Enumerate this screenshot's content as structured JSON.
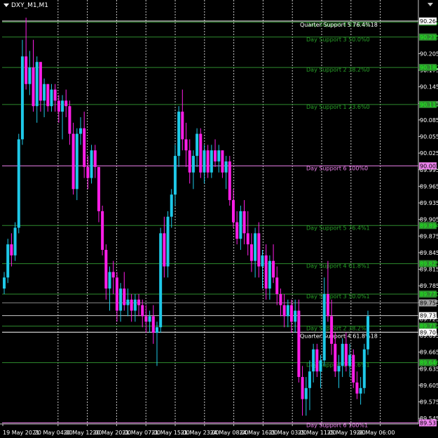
{
  "window": {
    "title": "DXY_M1,M1"
  },
  "colors": {
    "background": "#000000",
    "bull": "#1ec8e8",
    "bear": "#ff1ee8",
    "support_line": "#2e8b2e",
    "support_text": "#28a028",
    "support6_line": "#ee82ee",
    "quarter_line": "#ffffff",
    "grid": "#c8c8c8",
    "axis_text": "#ffffff"
  },
  "chart_data": {
    "type": "candlestick",
    "ylim": [
      89.535,
      90.283
    ],
    "y_ticks": [
      "90.205",
      "90.175",
      "90.145",
      "90.115",
      "90.085",
      "90.055",
      "90.025",
      "89.995",
      "89.965",
      "89.935",
      "89.905",
      "89.875",
      "89.845",
      "89.815",
      "89.785",
      "89.755",
      "89.725",
      "89.695",
      "89.665",
      "89.635",
      "89.605",
      "89.575",
      "89.545"
    ],
    "x_ticks": [
      "19 May 2021",
      "20 May 04:00",
      "20 May 12:00",
      "20 May 20:00",
      "21 May 07:00",
      "21 May 15:00",
      "21 May 23:00",
      "24 May 08:00",
      "24 May 16:00",
      "25 May 03:00",
      "25 May 11:00",
      "25 May 19:00",
      "26 May 06:00"
    ],
    "levels": [
      {
        "value": 90.262,
        "label": "Day Support 4 61.8%0",
        "kind": "support",
        "tag": "90.262"
      },
      {
        "value": 90.264,
        "label": "Quarter Support 5 76.4%18",
        "kind": "quarter",
        "tag": "90.264"
      },
      {
        "value": 90.235,
        "label": "Day Support 3 50.0%0",
        "kind": "support",
        "tag": "90.235"
      },
      {
        "value": 90.18,
        "label": "Day Support 2 38.2%0",
        "kind": "support",
        "tag": "90.180"
      },
      {
        "value": 90.113,
        "label": "Day Support 1 23.6%0",
        "kind": "support",
        "tag": "90.113"
      },
      {
        "value": 90.002,
        "label": "Day Support 6 100%0",
        "kind": "support6",
        "tag": "90.002"
      },
      {
        "value": 89.894,
        "label": "Day Support 5 76.4%1",
        "kind": "support",
        "tag": "89.894"
      },
      {
        "value": 89.825,
        "label": "Day Support 4 61.8%1",
        "kind": "support",
        "tag": "89.825"
      },
      {
        "value": 89.77,
        "label": "Day Support 3 50.0%1",
        "kind": "support",
        "tag": "89.770"
      },
      {
        "value": 89.712,
        "label": "Day Support 2 38.2%1",
        "kind": "support",
        "tag": "89.712"
      },
      {
        "value": 89.701,
        "label": "Quarter Support 4 61.8%18",
        "kind": "quarter",
        "tag": "89.701"
      },
      {
        "value": 89.646,
        "label": "Day Support 1 23.6%1",
        "kind": "support",
        "tag": "89.646"
      },
      {
        "value": 89.537,
        "label": "Day Support 6 100%1",
        "kind": "support6",
        "tag": "89.537"
      }
    ],
    "extra_tags": [
      {
        "value": 89.754,
        "tag": "89.754",
        "kind": "gray"
      },
      {
        "value": 89.731,
        "tag": "89.731",
        "kind": "white"
      }
    ],
    "candles": [
      [
        89.78,
        89.81,
        89.77,
        89.8
      ],
      [
        89.8,
        89.87,
        89.79,
        89.86
      ],
      [
        89.86,
        89.88,
        89.82,
        89.84
      ],
      [
        89.84,
        89.9,
        89.83,
        89.89
      ],
      [
        89.89,
        90.06,
        89.88,
        90.05
      ],
      [
        90.05,
        90.23,
        90.04,
        90.2
      ],
      [
        90.2,
        90.27,
        90.14,
        90.15
      ],
      [
        90.15,
        90.21,
        90.13,
        90.18
      ],
      [
        90.18,
        90.23,
        90.1,
        90.11
      ],
      [
        90.11,
        90.2,
        90.08,
        90.19
      ],
      [
        90.19,
        90.18,
        90.1,
        90.12
      ],
      [
        90.12,
        90.16,
        90.09,
        90.15
      ],
      [
        90.15,
        90.15,
        90.1,
        90.11
      ],
      [
        90.11,
        90.15,
        90.1,
        90.14
      ],
      [
        90.14,
        90.15,
        90.1,
        90.12
      ],
      [
        90.12,
        90.13,
        90.08,
        90.1
      ],
      [
        90.1,
        90.13,
        90.05,
        90.12
      ],
      [
        90.12,
        90.14,
        90.09,
        90.11
      ],
      [
        90.11,
        90.12,
        90.04,
        90.06
      ],
      [
        90.06,
        90.08,
        89.95,
        89.96
      ],
      [
        89.96,
        90.07,
        89.94,
        90.06
      ],
      [
        90.06,
        90.09,
        90.04,
        90.07
      ],
      [
        90.07,
        90.1,
        89.98,
        90.0
      ],
      [
        90.0,
        90.02,
        89.96,
        89.98
      ],
      [
        89.98,
        90.04,
        89.97,
        90.03
      ],
      [
        90.03,
        90.04,
        89.98,
        90.0
      ],
      [
        90.0,
        89.99,
        89.9,
        89.92
      ],
      [
        89.92,
        89.93,
        89.84,
        89.85
      ],
      [
        89.85,
        89.86,
        89.76,
        89.78
      ],
      [
        89.78,
        89.82,
        89.74,
        89.81
      ],
      [
        89.81,
        89.83,
        89.77,
        89.8
      ],
      [
        89.8,
        89.81,
        89.72,
        89.74
      ],
      [
        89.74,
        89.79,
        89.72,
        89.78
      ],
      [
        89.78,
        89.81,
        89.74,
        89.75
      ],
      [
        89.75,
        89.78,
        89.73,
        89.76
      ],
      [
        89.76,
        89.77,
        89.72,
        89.74
      ],
      [
        89.74,
        89.77,
        89.72,
        89.76
      ],
      [
        89.76,
        89.77,
        89.73,
        89.75
      ],
      [
        89.75,
        89.76,
        89.71,
        89.73
      ],
      [
        89.73,
        89.75,
        89.7,
        89.72
      ],
      [
        89.72,
        89.74,
        89.7,
        89.73
      ],
      [
        89.73,
        89.75,
        89.68,
        89.7
      ],
      [
        89.7,
        89.72,
        89.64,
        89.71
      ],
      [
        89.71,
        89.89,
        89.7,
        89.88
      ],
      [
        89.88,
        89.91,
        89.8,
        89.82
      ],
      [
        89.82,
        89.92,
        89.8,
        89.91
      ],
      [
        89.91,
        89.96,
        89.89,
        89.95
      ],
      [
        89.95,
        90.04,
        89.93,
        90.02
      ],
      [
        90.02,
        90.11,
        90.0,
        90.1
      ],
      [
        90.1,
        90.14,
        90.03,
        90.05
      ],
      [
        90.05,
        90.08,
        90.0,
        90.03
      ],
      [
        90.03,
        90.05,
        89.97,
        89.99
      ],
      [
        89.99,
        90.03,
        89.96,
        90.02
      ],
      [
        90.02,
        90.07,
        90.0,
        90.06
      ],
      [
        90.06,
        90.07,
        89.98,
        89.99
      ],
      [
        89.99,
        90.04,
        89.97,
        90.03
      ],
      [
        90.03,
        90.04,
        89.98,
        89.99
      ],
      [
        89.99,
        90.04,
        89.98,
        90.03
      ],
      [
        90.03,
        90.05,
        90.0,
        90.01
      ],
      [
        90.01,
        90.04,
        89.99,
        90.03
      ],
      [
        90.03,
        90.03,
        89.98,
        89.99
      ],
      [
        89.99,
        90.02,
        89.96,
        90.01
      ],
      [
        90.01,
        90.02,
        89.93,
        89.94
      ],
      [
        89.94,
        89.96,
        89.89,
        89.9
      ],
      [
        89.9,
        89.92,
        89.86,
        89.87
      ],
      [
        89.87,
        89.93,
        89.85,
        89.92
      ],
      [
        89.92,
        89.94,
        89.86,
        89.88
      ],
      [
        89.88,
        89.92,
        89.84,
        89.86
      ],
      [
        89.86,
        89.88,
        89.81,
        89.83
      ],
      [
        89.83,
        89.89,
        89.8,
        89.88
      ],
      [
        89.88,
        89.9,
        89.8,
        89.82
      ],
      [
        89.82,
        89.85,
        89.78,
        89.84
      ],
      [
        89.84,
        89.86,
        89.76,
        89.78
      ],
      [
        89.78,
        89.84,
        89.76,
        89.83
      ],
      [
        89.83,
        89.86,
        89.79,
        89.8
      ],
      [
        89.8,
        89.82,
        89.75,
        89.77
      ],
      [
        89.77,
        89.78,
        89.73,
        89.75
      ],
      [
        89.75,
        89.77,
        89.71,
        89.73
      ],
      [
        89.73,
        89.76,
        89.71,
        89.75
      ],
      [
        89.75,
        89.76,
        89.7,
        89.72
      ],
      [
        89.72,
        89.76,
        89.7,
        89.74
      ],
      [
        89.74,
        89.76,
        89.61,
        89.62
      ],
      [
        89.62,
        89.64,
        89.55,
        89.58
      ],
      [
        89.58,
        89.62,
        89.55,
        89.6
      ],
      [
        89.6,
        89.65,
        89.56,
        89.63
      ],
      [
        89.63,
        89.68,
        89.61,
        89.67
      ],
      [
        89.67,
        89.68,
        89.62,
        89.63
      ],
      [
        89.63,
        89.66,
        89.6,
        89.65
      ],
      [
        89.65,
        89.8,
        89.64,
        89.77
      ],
      [
        89.77,
        89.83,
        89.72,
        89.73
      ],
      [
        89.73,
        89.76,
        89.66,
        89.68
      ],
      [
        89.68,
        89.7,
        89.62,
        89.63
      ],
      [
        89.63,
        89.66,
        89.6,
        89.64
      ],
      [
        89.64,
        89.69,
        89.62,
        89.68
      ],
      [
        89.68,
        89.7,
        89.63,
        89.64
      ],
      [
        89.64,
        89.68,
        89.62,
        89.66
      ],
      [
        89.66,
        89.67,
        89.6,
        89.61
      ],
      [
        89.61,
        89.63,
        89.58,
        89.59
      ],
      [
        89.59,
        89.62,
        89.57,
        89.6
      ],
      [
        89.6,
        89.68,
        89.59,
        89.67
      ],
      [
        89.67,
        89.74,
        89.66,
        89.73
      ]
    ]
  }
}
